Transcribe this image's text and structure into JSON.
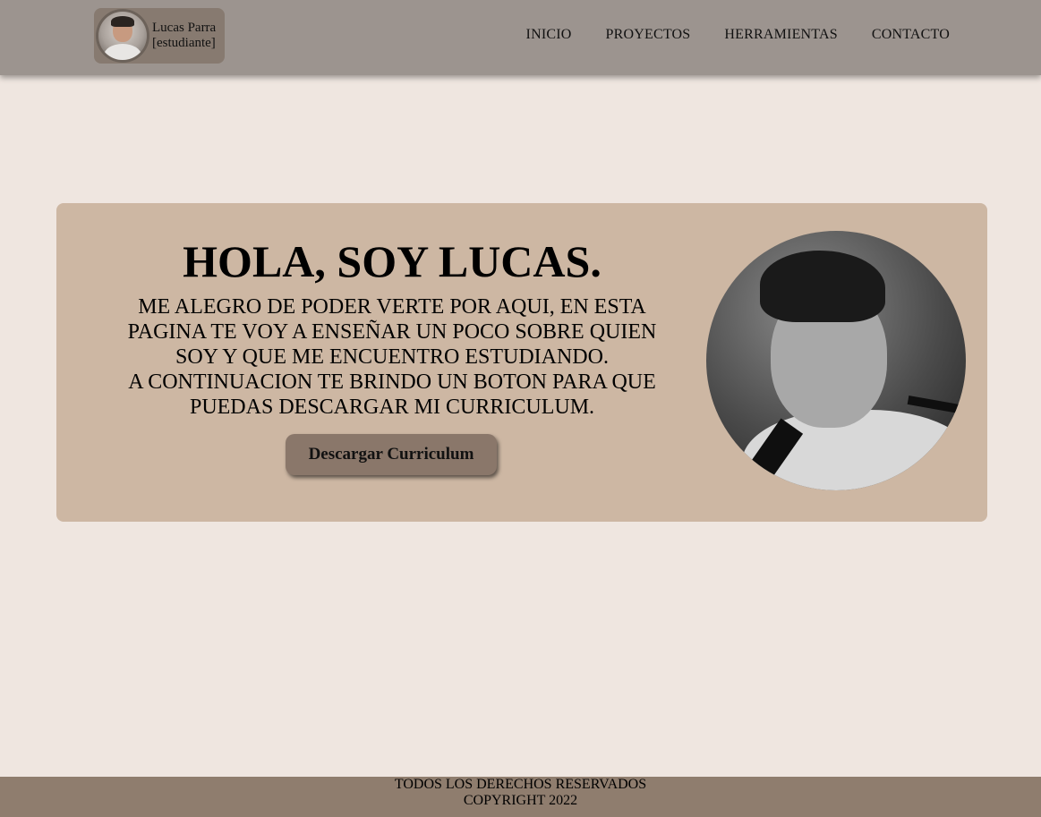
{
  "header": {
    "brand_name": "Lucas Parra",
    "brand_role": "[estudiante]",
    "nav": [
      {
        "label": "INICIO"
      },
      {
        "label": "PROYECTOS"
      },
      {
        "label": "HERRAMIENTAS"
      },
      {
        "label": "CONTACTO"
      }
    ]
  },
  "hero": {
    "title": "HOLA, SOY LUCAS.",
    "paragraph_1": "ME ALEGRO DE PODER VERTE POR AQUI, EN ESTA PAGINA TE VOY A ENSEÑAR UN POCO SOBRE QUIEN SOY Y QUE ME ENCUENTRO ESTUDIANDO.",
    "paragraph_2": "A CONTINUACION TE BRINDO UN BOTON PARA QUE PUEDAS DESCARGAR MI CURRICULUM.",
    "button_label": "Descargar Curriculum"
  },
  "footer": {
    "line_1": "TODOS LOS DERECHOS RESERVADOS",
    "line_2": "COPYRIGHT 2022"
  },
  "colors": {
    "page_background": "#efe6e0",
    "navbar": "#9c948f",
    "hero_card": "#cdb7a3",
    "button": "#8a776a",
    "footer": "#8f7d6e"
  }
}
